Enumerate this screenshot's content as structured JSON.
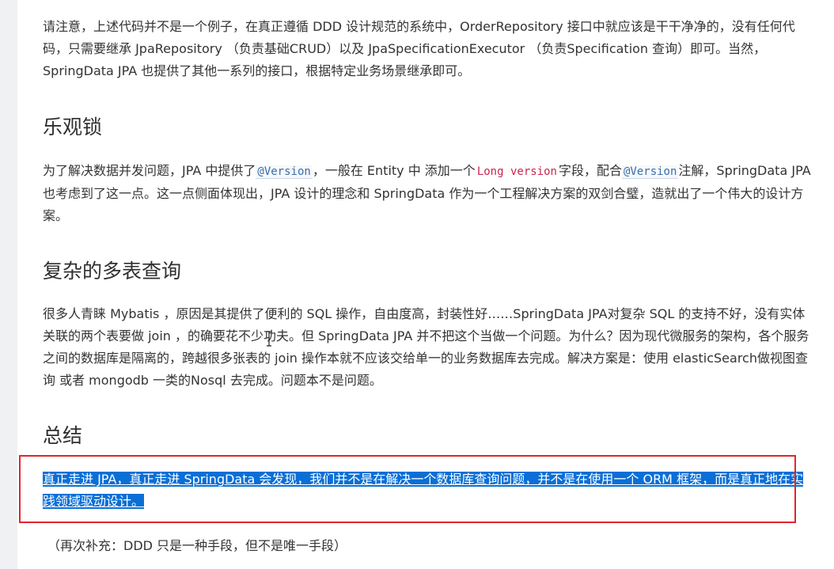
{
  "intro": {
    "text": "请注意，上述代码并不是一个例子，在真正遵循 DDD 设计规范的系统中，OrderRepository 接口中就应该是干干净净的，没有任何代码，只需要继承 JpaRepository （负责基础CRUD）以及 JpaSpecificationExecutor （负责Specification 查询）即可。当然， SpringData JPA 也提供了其他一系列的接口，根据特定业务场景继承即可。"
  },
  "optimistic_lock": {
    "heading": "乐观锁",
    "part1": "为了解决数据并发问题，JPA 中提供了",
    "code1": "@Version",
    "part2": "，一般在 Entity 中 添加一个",
    "code2": "Long version",
    "part3": "字段，配合",
    "code3": "@Version",
    "part4": "注解，SpringData JPA 也考虑到了这一点。这一点侧面体现出，JPA 设计的理念和 SpringData 作为一个工程解决方案的双剑合璧，造就出了一个伟大的设计方案。"
  },
  "complex_query": {
    "heading": "复杂的多表查询",
    "text": "很多人青睐 Mybatis ，原因是其提供了便利的 SQL 操作，自由度高，封装性好……SpringData JPA对复杂 SQL 的支持不好，没有实体关联的两个表要做 join ，的确要花不少功夫。但 SpringData JPA 并不把这个当做一个问题。为什么？因为现代微服务的架构，各个服务之间的数据库是隔离的，跨越很多张表的 join 操作本就不应该交给单一的业务数据库去完成。解决方案是：使用 elasticSearch做视图查询 或者 mongodb 一类的Nosql 去完成。问题本不是问题。"
  },
  "summary": {
    "heading": "总结",
    "selected_text": "真正走进 JPA，真正走进 SpringData 会发现，我们并不是在解决一个数据库查询问题，并不是在使用一个 ORM 框架，而是真正地在实践领域驱动设计。",
    "note": "（再次补充：DDD 只是一种手段，但不是唯一手段）"
  },
  "colors": {
    "highlight_border": "#e0262d",
    "selection": "#0a6fd6",
    "code_blue": "#3b6ea8",
    "code_red": "#c7254e"
  },
  "cursor_icon": "text-cursor-icon"
}
